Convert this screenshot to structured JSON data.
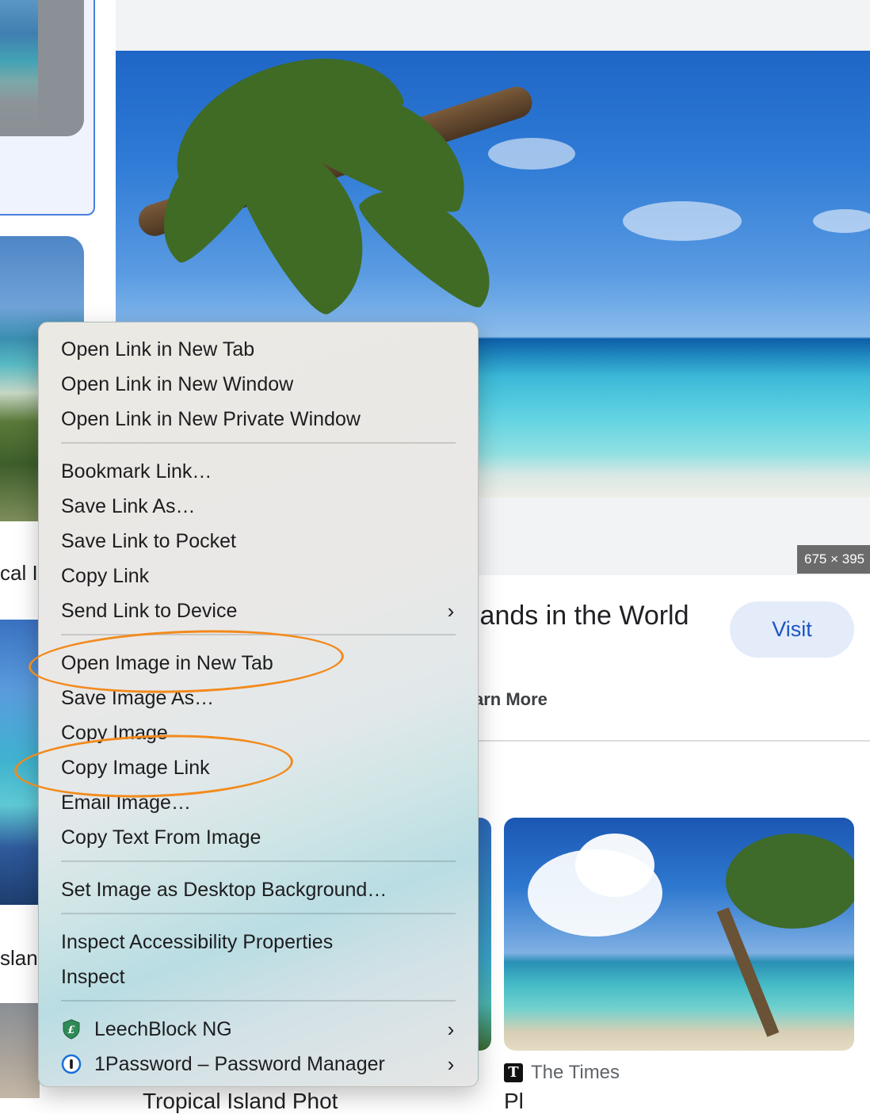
{
  "left_column": {
    "caption_1": "cal I",
    "caption_2": "slan"
  },
  "preview": {
    "dimensions": "675 × 395",
    "title": "lands in the World",
    "visit_label": "Visit",
    "learn_more": "arn More"
  },
  "related": {
    "source_name": "The Times",
    "source_logo": "T",
    "bottom_text_left": "Tropical Island Phot",
    "bottom_text_right": "Pl"
  },
  "context_menu": {
    "items": [
      {
        "label": "Open Link in New Tab"
      },
      {
        "label": "Open Link in New Window"
      },
      {
        "label": "Open Link in New Private Window"
      },
      {
        "label": "Bookmark Link…"
      },
      {
        "label": "Save Link As…"
      },
      {
        "label": "Save Link to Pocket"
      },
      {
        "label": "Copy Link"
      },
      {
        "label": "Send Link to Device",
        "submenu": true
      },
      {
        "label": "Open Image in New Tab"
      },
      {
        "label": "Save Image As…"
      },
      {
        "label": "Copy Image"
      },
      {
        "label": "Copy Image Link"
      },
      {
        "label": "Email Image…"
      },
      {
        "label": "Copy Text From Image"
      },
      {
        "label": "Set Image as Desktop Background…"
      },
      {
        "label": "Inspect Accessibility Properties"
      },
      {
        "label": "Inspect"
      },
      {
        "label": "LeechBlock NG",
        "submenu": true,
        "icon": "leechblock-shield-icon"
      },
      {
        "label": "1Password – Password Manager",
        "submenu": true,
        "icon": "1password-icon"
      }
    ],
    "chevron": "›"
  },
  "colors": {
    "annotation": "#f28a1c",
    "visit_text": "#1a56c4",
    "visit_bg": "#e4ecfa"
  }
}
